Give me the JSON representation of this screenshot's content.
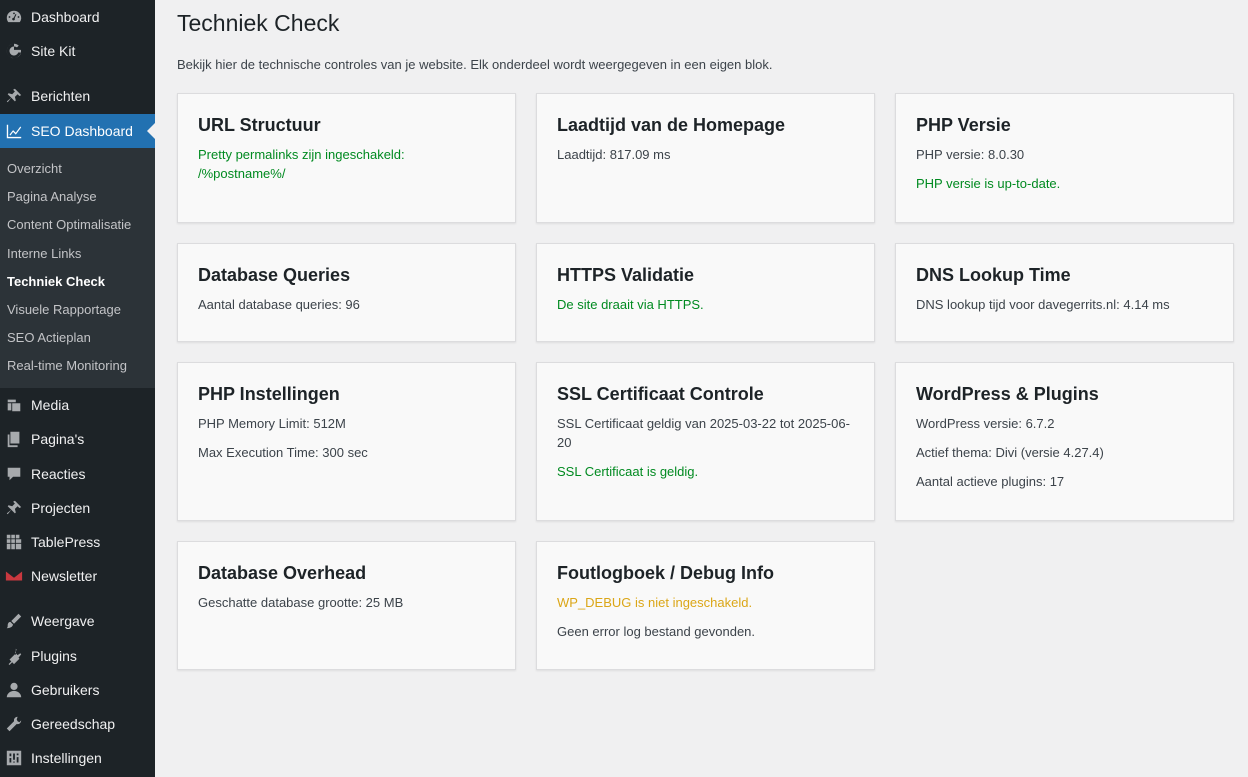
{
  "sidebar": {
    "menu_top": [
      {
        "label": "Dashboard",
        "icon": "dashboard-icon"
      },
      {
        "label": "Site Kit",
        "icon": "google-g-icon"
      },
      {
        "label": "Berichten",
        "icon": "pin-icon"
      },
      {
        "label": "SEO Dashboard",
        "icon": "chart-line-icon"
      }
    ],
    "submenu": [
      {
        "label": "Overzicht"
      },
      {
        "label": "Pagina Analyse"
      },
      {
        "label": "Content Optimalisatie"
      },
      {
        "label": "Interne Links"
      },
      {
        "label": "Techniek Check"
      },
      {
        "label": "Visuele Rapportage"
      },
      {
        "label": "SEO Actieplan"
      },
      {
        "label": "Real-time Monitoring"
      }
    ],
    "menu_bottom": [
      {
        "label": "Media",
        "icon": "media-icon"
      },
      {
        "label": "Pagina's",
        "icon": "pages-icon"
      },
      {
        "label": "Reacties",
        "icon": "comment-icon"
      },
      {
        "label": "Projecten",
        "icon": "pin-icon"
      },
      {
        "label": "TablePress",
        "icon": "table-icon"
      },
      {
        "label": "Newsletter",
        "icon": "envelope-icon"
      },
      {
        "label": "Weergave",
        "icon": "brush-icon"
      },
      {
        "label": "Plugins",
        "icon": "plugin-icon"
      },
      {
        "label": "Gebruikers",
        "icon": "user-icon"
      },
      {
        "label": "Gereedschap",
        "icon": "wrench-icon"
      },
      {
        "label": "Instellingen",
        "icon": "settings-icon"
      }
    ]
  },
  "page": {
    "title": "Techniek Check",
    "description": "Bekijk hier de technische controles van je website. Elk onderdeel wordt weergegeven in een eigen blok."
  },
  "cards": [
    {
      "title": "URL Structuur",
      "lines": [
        {
          "text": "Pretty permalinks zijn ingeschakeld: /%postname%/",
          "status": "ok"
        }
      ]
    },
    {
      "title": "Laadtijd van de Homepage",
      "lines": [
        {
          "text": "Laadtijd: 817.09 ms",
          "status": "normal"
        }
      ]
    },
    {
      "title": "PHP Versie",
      "lines": [
        {
          "text": "PHP versie: 8.0.30",
          "status": "normal"
        },
        {
          "text": "PHP versie is up-to-date.",
          "status": "ok"
        }
      ]
    },
    {
      "title": "Database Queries",
      "lines": [
        {
          "text": "Aantal database queries: 96",
          "status": "normal"
        }
      ]
    },
    {
      "title": "HTTPS Validatie",
      "lines": [
        {
          "text": "De site draait via HTTPS.",
          "status": "ok"
        }
      ]
    },
    {
      "title": "DNS Lookup Time",
      "lines": [
        {
          "text": "DNS lookup tijd voor davegerrits.nl: 4.14 ms",
          "status": "normal"
        }
      ]
    },
    {
      "title": "PHP Instellingen",
      "lines": [
        {
          "text": "PHP Memory Limit: 512M",
          "status": "normal"
        },
        {
          "text": "Max Execution Time: 300 sec",
          "status": "normal"
        }
      ]
    },
    {
      "title": "SSL Certificaat Controle",
      "lines": [
        {
          "text": "SSL Certificaat geldig van 2025-03-22 tot 2025-06-20",
          "status": "normal"
        },
        {
          "text": "SSL Certificaat is geldig.",
          "status": "ok"
        }
      ]
    },
    {
      "title": "WordPress & Plugins",
      "lines": [
        {
          "text": "WordPress versie: 6.7.2",
          "status": "normal"
        },
        {
          "text": "Actief thema: Divi (versie 4.27.4)",
          "status": "normal"
        },
        {
          "text": "Aantal actieve plugins: 17",
          "status": "normal"
        }
      ]
    },
    {
      "title": "Database Overhead",
      "lines": [
        {
          "text": "Geschatte database grootte: 25 MB",
          "status": "normal"
        }
      ]
    },
    {
      "title": "Foutlogboek / Debug Info",
      "lines": [
        {
          "text": "WP_DEBUG is niet ingeschakeld.",
          "status": "warn"
        },
        {
          "text": "Geen error log bestand gevonden.",
          "status": "normal"
        }
      ]
    }
  ],
  "colors": {
    "sidebar_bg": "#1d2327",
    "active": "#2271b1",
    "ok": "#008a20",
    "warn": "#dba617"
  }
}
